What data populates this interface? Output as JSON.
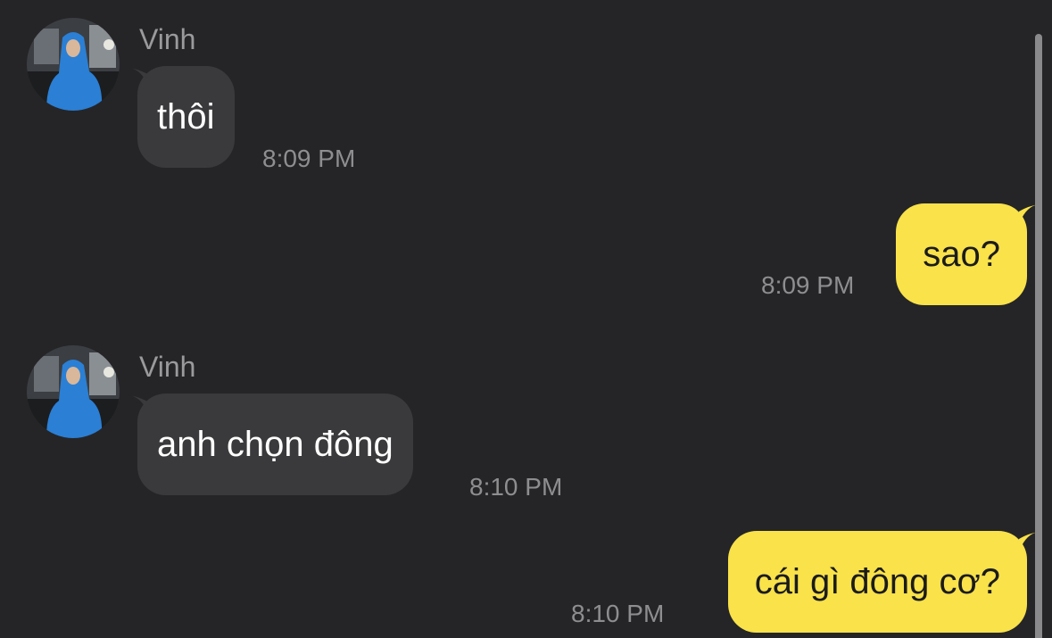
{
  "colors": {
    "background": "#252527",
    "incoming_bubble": "#3a3a3c",
    "outgoing_bubble": "#f9e24a",
    "timestamp": "#8e8e90",
    "sender_name": "#9a9a9c"
  },
  "messages": [
    {
      "direction": "incoming",
      "sender": "Vinh",
      "avatar_icon": "user-avatar-photo",
      "text": "thôi",
      "time": "8:09 PM"
    },
    {
      "direction": "outgoing",
      "text": "sao?",
      "time": "8:09 PM"
    },
    {
      "direction": "incoming",
      "sender": "Vinh",
      "avatar_icon": "user-avatar-photo",
      "text": "anh chọn đông",
      "time": "8:10 PM"
    },
    {
      "direction": "outgoing",
      "text": "cái gì đông cơ?",
      "time": "8:10 PM"
    }
  ]
}
